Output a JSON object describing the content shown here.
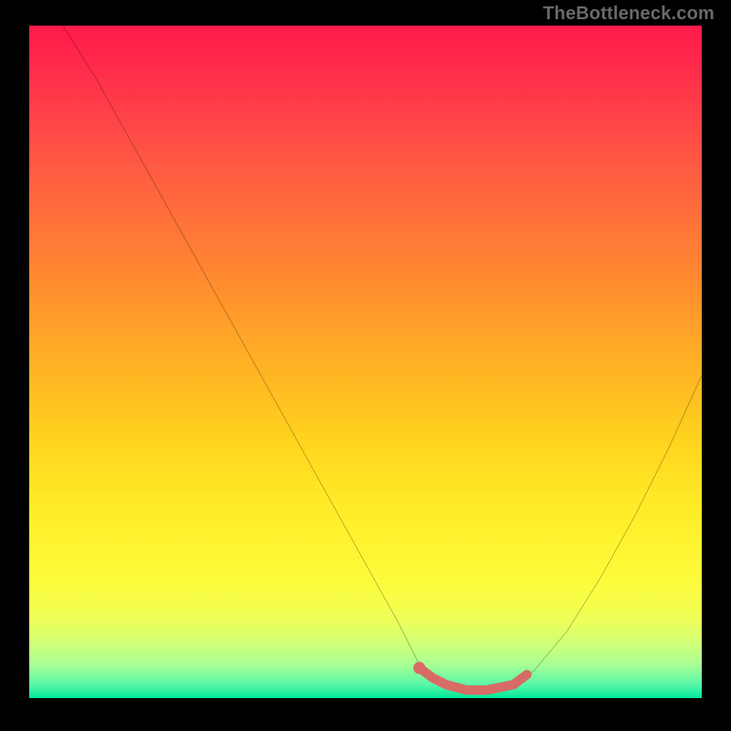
{
  "watermark": "TheBottleneck.com",
  "chart_data": {
    "type": "line",
    "title": "",
    "xlabel": "",
    "ylabel": "",
    "xlim": [
      0,
      100
    ],
    "ylim": [
      0,
      100
    ],
    "grid": false,
    "legend": false,
    "series": [
      {
        "name": "bottleneck-curve",
        "color": "#000000",
        "x": [
          5,
          10,
          15,
          20,
          25,
          30,
          35,
          40,
          45,
          50,
          55,
          58,
          62,
          65,
          68,
          72,
          75,
          80,
          85,
          90,
          95,
          100
        ],
        "y": [
          100,
          92,
          83,
          74,
          65,
          56,
          47,
          38,
          29,
          20,
          11,
          5,
          2,
          1,
          1,
          2,
          4,
          10,
          18,
          27,
          37,
          48
        ]
      }
    ],
    "highlight_segment": {
      "name": "optimal-range",
      "color": "#d86b66",
      "x": [
        58,
        60,
        62,
        65,
        68,
        72,
        74
      ],
      "y": [
        4.5,
        3,
        2,
        1.2,
        1.2,
        2,
        3.5
      ]
    },
    "highlight_dot": {
      "x": 58,
      "y": 4.5,
      "r": 5,
      "color": "#d86b66"
    },
    "background_gradient": {
      "top_color": "#ff1a4b",
      "mid_color": "#ffe826",
      "bottom_color": "#00e89a"
    }
  }
}
